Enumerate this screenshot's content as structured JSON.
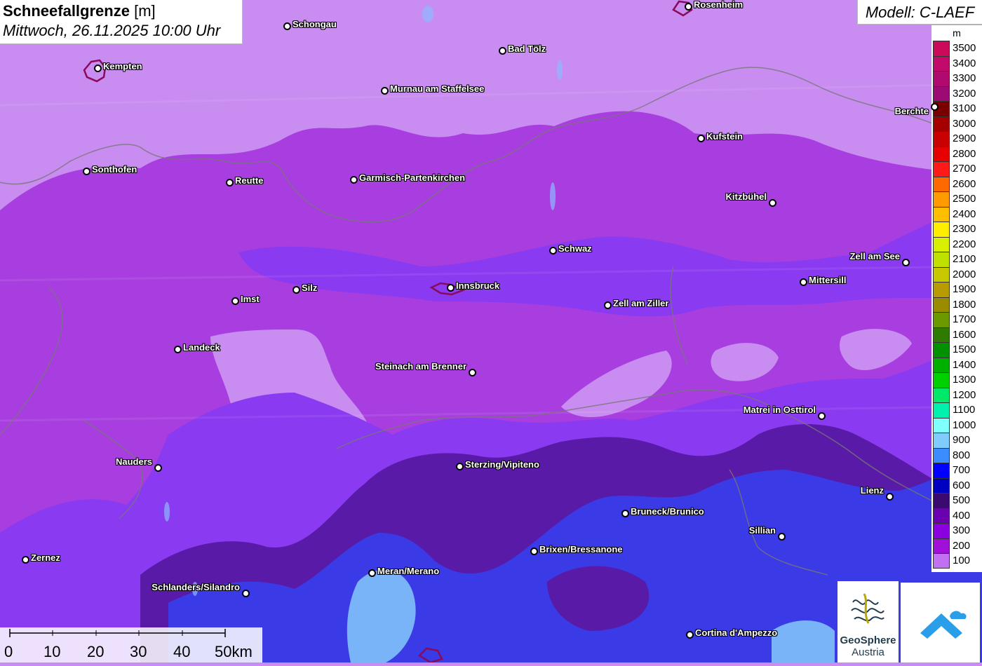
{
  "header": {
    "title": "Schneefallgrenze",
    "unit": "[m]",
    "datetime": "Mittwoch, 26.11.2025 10:00 Uhr"
  },
  "model_label": "Modell: C-LAEF",
  "legend": {
    "unit": "m",
    "steps": [
      {
        "value": "3500",
        "color": "#cc0a5c"
      },
      {
        "value": "3400",
        "color": "#c20a6a"
      },
      {
        "value": "3300",
        "color": "#b00a6f"
      },
      {
        "value": "3200",
        "color": "#9c0a73"
      },
      {
        "value": "3100",
        "color": "#7a0000"
      },
      {
        "value": "3000",
        "color": "#a50000"
      },
      {
        "value": "2900",
        "color": "#c80000"
      },
      {
        "value": "2800",
        "color": "#e60000"
      },
      {
        "value": "2700",
        "color": "#ff1a1a"
      },
      {
        "value": "2600",
        "color": "#ff6a00"
      },
      {
        "value": "2500",
        "color": "#ff9a00"
      },
      {
        "value": "2400",
        "color": "#ffbf00"
      },
      {
        "value": "2300",
        "color": "#ffee00"
      },
      {
        "value": "2200",
        "color": "#d8f000"
      },
      {
        "value": "2100",
        "color": "#c0e000"
      },
      {
        "value": "2000",
        "color": "#c8c800"
      },
      {
        "value": "1900",
        "color": "#b89b00"
      },
      {
        "value": "1800",
        "color": "#9a8c00"
      },
      {
        "value": "1700",
        "color": "#6a9a00"
      },
      {
        "value": "1600",
        "color": "#2f7a00"
      },
      {
        "value": "1500",
        "color": "#009000"
      },
      {
        "value": "1400",
        "color": "#00b000"
      },
      {
        "value": "1300",
        "color": "#00d000"
      },
      {
        "value": "1200",
        "color": "#00e86a"
      },
      {
        "value": "1100",
        "color": "#00f0b0"
      },
      {
        "value": "1000",
        "color": "#80ffff"
      },
      {
        "value": "900",
        "color": "#80ccff"
      },
      {
        "value": "800",
        "color": "#3a8cff"
      },
      {
        "value": "700",
        "color": "#0000ff"
      },
      {
        "value": "600",
        "color": "#0000c0"
      },
      {
        "value": "500",
        "color": "#3a0a70"
      },
      {
        "value": "400",
        "color": "#6a00b0"
      },
      {
        "value": "300",
        "color": "#8a00e0"
      },
      {
        "value": "200",
        "color": "#a010d8"
      },
      {
        "value": "100",
        "color": "#c070f0"
      }
    ]
  },
  "cities": [
    {
      "name": "Rosenheim"
    },
    {
      "name": "Schongau"
    },
    {
      "name": "Kempten"
    },
    {
      "name": "Bad Tölz"
    },
    {
      "name": "Murnau am Staffelsee"
    },
    {
      "name": "Berchte"
    },
    {
      "name": "Kufstein"
    },
    {
      "name": "Sonthofen"
    },
    {
      "name": "Reutte"
    },
    {
      "name": "Garmisch-Partenkirchen"
    },
    {
      "name": "Kitzbühel"
    },
    {
      "name": "Schwaz"
    },
    {
      "name": "Zell am See"
    },
    {
      "name": "Mittersill"
    },
    {
      "name": "Silz"
    },
    {
      "name": "Innsbruck"
    },
    {
      "name": "Imst"
    },
    {
      "name": "Zell am Ziller"
    },
    {
      "name": "Landeck"
    },
    {
      "name": "Steinach am Brenner"
    },
    {
      "name": "Matrei in Osttirol"
    },
    {
      "name": "Nauders"
    },
    {
      "name": "Sterzing/Vipiteno"
    },
    {
      "name": "Lienz"
    },
    {
      "name": "Bruneck/Brunico"
    },
    {
      "name": "Sillian"
    },
    {
      "name": "Brixen/Bressanone"
    },
    {
      "name": "Zernez"
    },
    {
      "name": "Meran/Merano"
    },
    {
      "name": "Schlanders/Silandro"
    },
    {
      "name": "Cortina d'Ampezzo"
    }
  ],
  "scale_bar": {
    "labels": [
      "0",
      "10",
      "20",
      "30",
      "40",
      "50km"
    ]
  },
  "logos": {
    "geosphere_name": "GeoSphere",
    "geosphere_sub": "Austria"
  }
}
